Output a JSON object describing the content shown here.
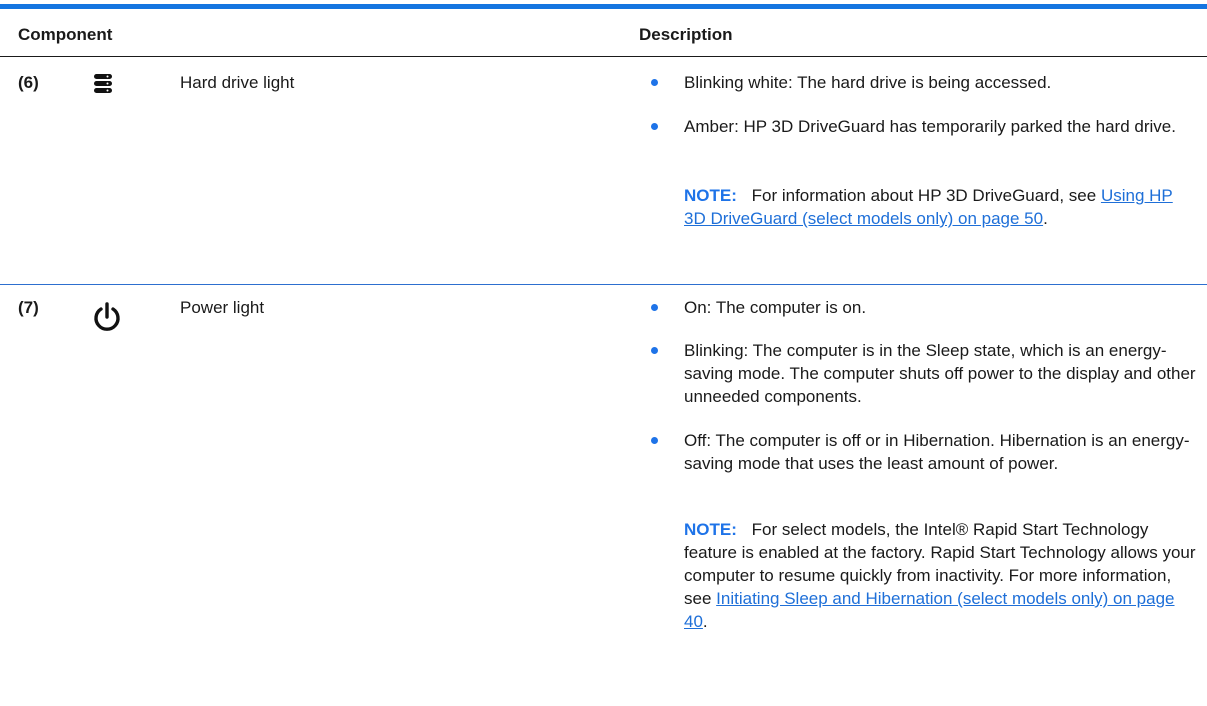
{
  "table": {
    "headers": {
      "component": "Component",
      "description": "Description"
    },
    "rows": [
      {
        "number": "(6)",
        "icon": "hard-drive-icon",
        "component": "Hard drive light",
        "items": [
          "Blinking white: The hard drive is being accessed.",
          "Amber: HP 3D DriveGuard has temporarily parked the hard drive."
        ],
        "note": {
          "label": "NOTE:",
          "text": "For information about HP 3D DriveGuard, see",
          "link": "Using HP 3D DriveGuard (select models only) on page 50",
          "end": "."
        }
      },
      {
        "number": "(7)",
        "icon": "power-icon",
        "component": "Power light",
        "items": [
          "On: The computer is on.",
          "Blinking: The computer is in the Sleep state, which is an energy-saving mode. The computer shuts off power to the display and other unneeded components.",
          "Off: The computer is off or in Hibernation. Hibernation is an energy-saving mode that uses the least amount of power."
        ],
        "note": {
          "label": "NOTE:",
          "text": "For select models, the Intel® Rapid Start Technology feature is enabled at the factory. Rapid Start Technology allows your computer to resume quickly from inactivity. For more information, see",
          "link": "Initiating Sleep and Hibernation (select models only) on page 40",
          "end": "."
        }
      }
    ]
  }
}
